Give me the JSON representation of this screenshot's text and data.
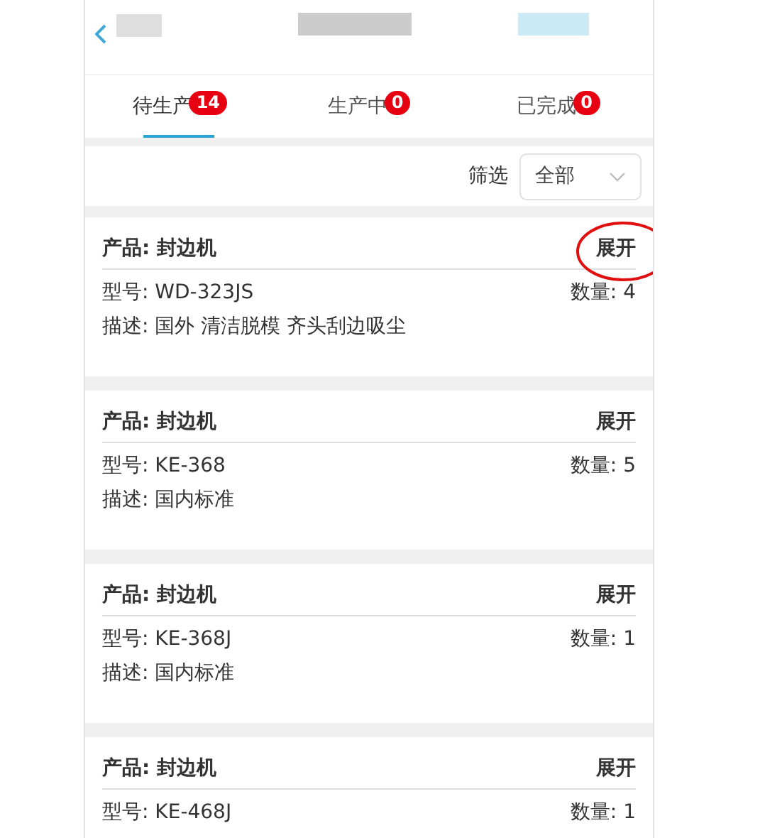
{
  "tabs": [
    {
      "label": "待生产",
      "count": "14",
      "selected": true
    },
    {
      "label": "生产中",
      "count": "0",
      "selected": false
    },
    {
      "label": "已完成",
      "count": "0",
      "selected": false
    }
  ],
  "filter": {
    "label": "筛选",
    "value": "全部"
  },
  "orders": [
    {
      "product": "产品: 封边机",
      "toggle": "展开",
      "model": "型号: WD-323JS",
      "quantity": "数量: 4",
      "description": "描述: 国外 清洁脱模 齐头刮边吸尘",
      "circled": true
    },
    {
      "product": "产品: 封边机",
      "toggle": "展开",
      "model": "型号: KE-368",
      "quantity": "数量: 5",
      "description": "描述: 国内标准",
      "circled": false
    },
    {
      "product": "产品: 封边机",
      "toggle": "展开",
      "model": "型号: KE-368J",
      "quantity": "数量: 1",
      "description": "描述: 国内标准",
      "circled": false
    },
    {
      "product": "产品: 封边机",
      "toggle": "展开",
      "model": "型号: KE-468J",
      "quantity": "数量: 1",
      "circled": false
    }
  ]
}
